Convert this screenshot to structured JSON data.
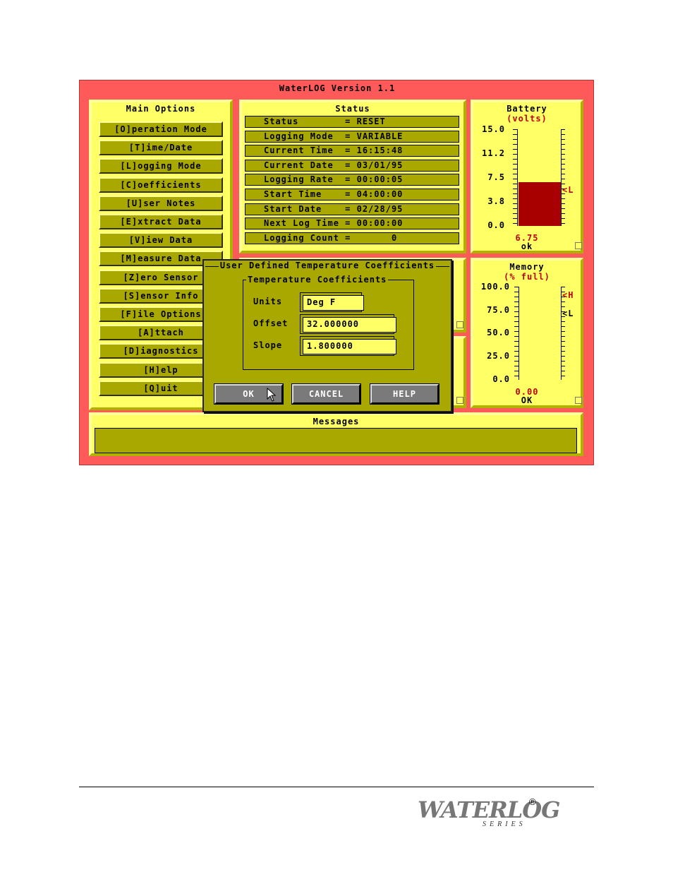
{
  "window": {
    "title": "WaterLOG Version 1.1"
  },
  "main_options": {
    "title": "Main Options",
    "items": [
      "[O]peration Mode",
      "[T]ime/Date",
      "[L]ogging Mode",
      "[C]oefficients",
      "[U]ser Notes",
      "[E]xtract Data",
      "[V]iew Data",
      "[M]easure Data",
      "[Z]ero Sensor",
      "[S]ensor Info",
      "[F]ile Options",
      "[A]ttach",
      "[D]iagnostics",
      "[H]elp",
      "[Q]uit"
    ]
  },
  "status": {
    "title": "Status",
    "rows": [
      "Status        = RESET",
      "Logging Mode  = VARIABLE",
      "Current Time  = 16:15:48",
      "Current Date  = 03/01/95",
      "Logging Rate  = 00:00:05",
      "Start Time    = 04:00:00",
      "Start Date    = 02/28/95",
      "Next Log Time = 00:00:00",
      "Logging Count =       0"
    ]
  },
  "battery": {
    "title": "Battery",
    "unit": "(volts)",
    "ticks": [
      "15.0",
      "11.2",
      "7.5",
      "3.8",
      "0.0"
    ],
    "value": "6.75",
    "state": "ok",
    "level_fraction": 0.45,
    "marker": "L",
    "fill_color": "#a80000"
  },
  "memory": {
    "title": "Memory",
    "unit": "(% full)",
    "ticks": [
      "100.0",
      "75.0",
      "50.0",
      "25.0",
      "0.0"
    ],
    "value": "0.00",
    "state": "OK",
    "marker_high": "H",
    "marker_low": "L"
  },
  "messages": {
    "title": "Messages",
    "text": ""
  },
  "dialog": {
    "title": "User Defined Temperature Coefficients",
    "group_title": "Temperature Coefficients",
    "units_label": "Units",
    "units_value": "Deg F",
    "offset_label": "Offset",
    "offset_value": "32.000000",
    "slope_label": "Slope",
    "slope_value": "1.800000",
    "ok_label": "OK",
    "cancel_label": "CANCEL",
    "help_label": "HELP"
  },
  "footer": {
    "logo_text": "WATERLOG",
    "logo_sub": "SERIES",
    "registered": "®"
  },
  "colors": {
    "window_bg": "#ff5a5a",
    "panel_bg": "#ffff66",
    "control_bg": "#a8a800",
    "accent_red": "#c00000"
  }
}
